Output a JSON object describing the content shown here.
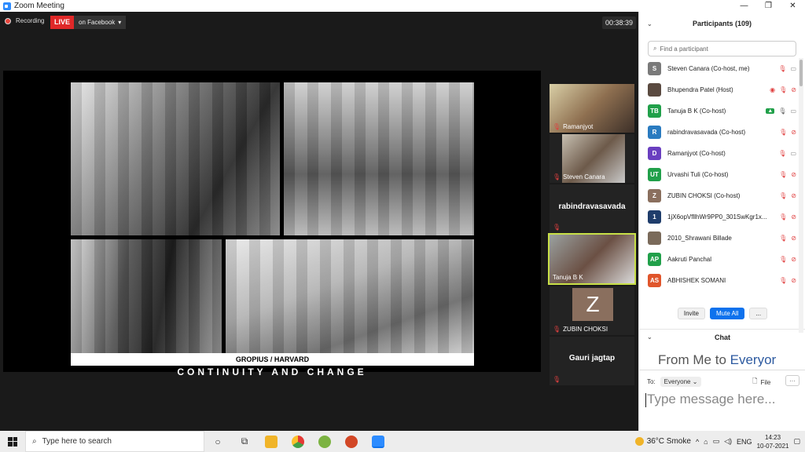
{
  "window": {
    "title": "Zoom Meeting",
    "minimize": "—",
    "maximize": "❐",
    "close": "✕"
  },
  "stage": {
    "recording_label": "Recording",
    "live_label": "LIVE",
    "live_target": "on Facebook",
    "live_dropdown": "▾",
    "timer": "00:38:39",
    "slide": {
      "caption": "GROPIUS / HARVARD",
      "subtitle": "CONTINUITY AND CHANGE"
    },
    "thumbnails": [
      {
        "name": "Ramanjyot",
        "mic": "🎙"
      },
      {
        "name": "Steven Canara",
        "mic": "🎙"
      },
      {
        "name": "rabindravasavada",
        "mic": "🎙"
      },
      {
        "name": "Tanuja B K",
        "mic": ""
      },
      {
        "name": "ZUBIN CHOKSI",
        "mic": "🎙",
        "initial": "Z"
      },
      {
        "name": "Gauri jagtap",
        "mic": "🎙"
      }
    ]
  },
  "panel": {
    "title": "Participants (109)",
    "collapse": "⌄",
    "search_placeholder": "Find a participant",
    "search_icon": "⌕",
    "participants": [
      {
        "name": "Steven Canara (Co-host, me)",
        "initials": "S",
        "color": "#7a7a7a",
        "icons": [
          "mic-off",
          "cam"
        ]
      },
      {
        "name": "Bhupendra Patel (Host)",
        "initials": "",
        "color": "#5a4a40",
        "icons": [
          "rec",
          "mic-off",
          "cam-off"
        ]
      },
      {
        "name": "Tanuja B K (Co-host)",
        "initials": "TB",
        "color": "#21a04a",
        "icons": [
          "share",
          "mic",
          "cam"
        ]
      },
      {
        "name": "rabindravasavada (Co-host)",
        "initials": "R",
        "color": "#2a7bc0",
        "icons": [
          "mic-off",
          "cam-off"
        ]
      },
      {
        "name": "Ramanjyot (Co-host)",
        "initials": "D",
        "color": "#6a3fc0",
        "icons": [
          "mic-off",
          "cam"
        ]
      },
      {
        "name": "Urvashi Tuli (Co-host)",
        "initials": "UT",
        "color": "#21a04a",
        "icons": [
          "mic-off",
          "cam-off"
        ]
      },
      {
        "name": "ZUBIN CHOKSI (Co-host)",
        "initials": "Z",
        "color": "#8a6f5e",
        "icons": [
          "mic-off",
          "cam-off"
        ]
      },
      {
        "name": "1jX6opVfllhWr9PP0_301SwKgr1x...",
        "initials": "1",
        "color": "#1f3d6b",
        "icons": [
          "mic-off",
          "cam-off"
        ]
      },
      {
        "name": "2010_Shrawani Billade",
        "initials": "",
        "color": "#7a6a5a",
        "icons": [
          "mic-off",
          "cam-off"
        ]
      },
      {
        "name": "Aakruti Panchal",
        "initials": "AP",
        "color": "#21a04a",
        "icons": [
          "mic-off",
          "cam-off"
        ]
      },
      {
        "name": "ABHISHEK SOMANI",
        "initials": "AS",
        "color": "#e0552b",
        "icons": [
          "mic-off",
          "cam-off"
        ]
      }
    ],
    "buttons": {
      "invite": "Invite",
      "mute_all": "Mute All",
      "more": "..."
    },
    "chat": {
      "title": "Chat",
      "preview_from": "From Me to ",
      "preview_to": "Everyor",
      "to_label": "To:",
      "to_value": "Everyone",
      "to_chevron": "⌄",
      "file_label": "File",
      "more": "···",
      "placeholder": "Type message here..."
    }
  },
  "taskbar": {
    "search_placeholder": "Type here to search",
    "weather": "36°C  Smoke",
    "lang": "ENG",
    "time": "14:23",
    "date": "10-07-2021"
  }
}
